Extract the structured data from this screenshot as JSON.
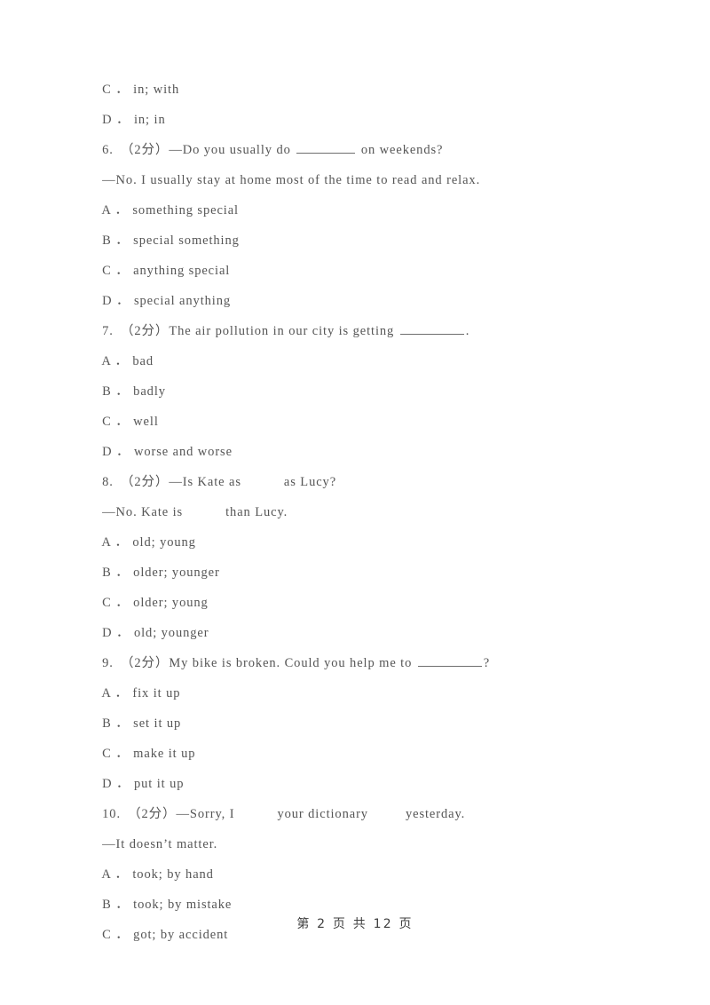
{
  "page": {
    "background": "#ffffff",
    "text_color": "#555555",
    "footer_text": "第 2 页 共 12 页",
    "footer_color": "#3f3f3f"
  },
  "lines": [
    {
      "id": "l01",
      "kind": "option",
      "text": "C ． in; with"
    },
    {
      "id": "l02",
      "kind": "option",
      "text": "D ． in; in"
    },
    {
      "id": "l03",
      "kind": "question",
      "number": "6.",
      "marks": "（2分）",
      "pre": "6.　（2分）—Do you usually do ",
      "post": " on weekends?",
      "blank": "underline-medium"
    },
    {
      "id": "l04",
      "kind": "continuation",
      "text": "—No. I usually stay at home most of the time to read and relax."
    },
    {
      "id": "l05",
      "kind": "option",
      "text": "A ． something special"
    },
    {
      "id": "l06",
      "kind": "option",
      "text": "B ． special something"
    },
    {
      "id": "l07",
      "kind": "option",
      "text": "C ． anything special"
    },
    {
      "id": "l08",
      "kind": "option",
      "text": "D ． special anything"
    },
    {
      "id": "l09",
      "kind": "question",
      "number": "7.",
      "marks": "（2分）",
      "pre": "7.　（2分）The air pollution in our city is getting ",
      "post": ".",
      "blank": "underline-large"
    },
    {
      "id": "l10",
      "kind": "option",
      "text": "A ． bad"
    },
    {
      "id": "l11",
      "kind": "option",
      "text": "B ． badly"
    },
    {
      "id": "l12",
      "kind": "option",
      "text": "C ． well"
    },
    {
      "id": "l13",
      "kind": "option",
      "text": "D ． worse and worse"
    },
    {
      "id": "l14",
      "kind": "question",
      "number": "8.",
      "marks": "（2分）",
      "pre": "8.　（2分）—Is Kate as",
      "post": "as Lucy?",
      "blank": "gap-medium"
    },
    {
      "id": "l15",
      "kind": "continuation",
      "pre": "—No. Kate is",
      "post": "than Lucy.",
      "blank": "gap-large"
    },
    {
      "id": "l16",
      "kind": "option",
      "text": "A ． old; young"
    },
    {
      "id": "l17",
      "kind": "option",
      "text": "B ． older; younger"
    },
    {
      "id": "l18",
      "kind": "option",
      "text": "C ． older; young"
    },
    {
      "id": "l19",
      "kind": "option",
      "text": "D ． old; younger"
    },
    {
      "id": "l20",
      "kind": "question",
      "number": "9.",
      "marks": "（2分）",
      "pre": "9.　（2分）My bike is broken. Could you help me to ",
      "post": "?",
      "blank": "underline-large"
    },
    {
      "id": "l21",
      "kind": "option",
      "text": "A ． fix it up"
    },
    {
      "id": "l22",
      "kind": "option",
      "text": "B ． set it up"
    },
    {
      "id": "l23",
      "kind": "option",
      "text": "C ． make it up"
    },
    {
      "id": "l24",
      "kind": "option",
      "text": "D ． put it up"
    },
    {
      "id": "l25",
      "kind": "question",
      "number": "10.",
      "marks": "（2分）",
      "pre": "10.　（2分）—Sorry, I",
      "mid": "your dictionary",
      "post": "yesterday.",
      "blank": "gap-double"
    },
    {
      "id": "l26",
      "kind": "continuation",
      "text": "—It doesn’t matter."
    },
    {
      "id": "l27",
      "kind": "option",
      "text": "A ． took; by hand"
    },
    {
      "id": "l28",
      "kind": "option",
      "text": "B ． took; by mistake"
    },
    {
      "id": "l29",
      "kind": "option",
      "text": "C ． got; by accident"
    }
  ]
}
